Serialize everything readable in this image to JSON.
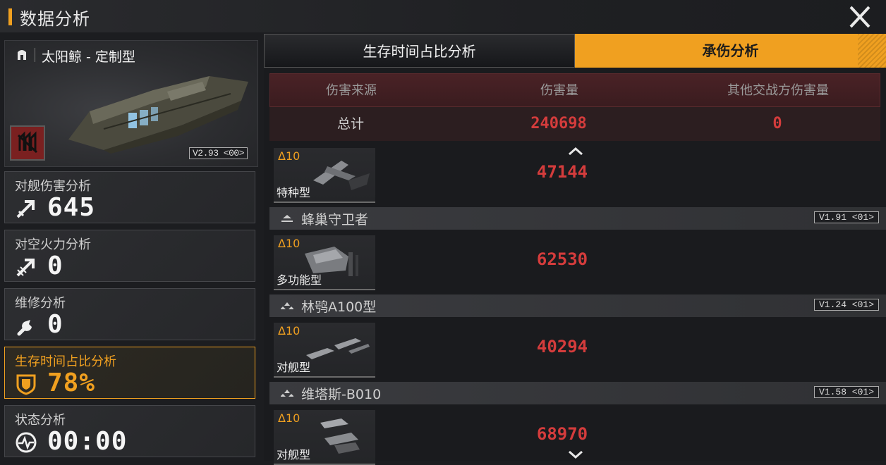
{
  "window": {
    "title": "数据分析"
  },
  "ship": {
    "name": "太阳鲸 - 定制型",
    "version": "V2.93 <00>"
  },
  "stats": [
    {
      "label": "对舰伤害分析",
      "value": "645",
      "icon": "anti-ship-icon"
    },
    {
      "label": "对空火力分析",
      "value": "0",
      "icon": "anti-air-icon"
    },
    {
      "label": "维修分析",
      "value": "0",
      "icon": "wrench-icon"
    },
    {
      "label": "生存时间占比分析",
      "value": "78%",
      "icon": "shield-icon",
      "active": true
    },
    {
      "label": "状态分析",
      "value": "00:00",
      "icon": "pulse-icon"
    }
  ],
  "tabs": [
    {
      "label": "生存时间占比分析",
      "active": false
    },
    {
      "label": "承伤分析",
      "active": true
    }
  ],
  "table": {
    "headers": [
      "伤害来源",
      "伤害量",
      "其他交战方伤害量"
    ],
    "total": {
      "label": "总计",
      "damage": "240698",
      "other": "0"
    }
  },
  "rows": [
    {
      "group": null,
      "level": "Δ10",
      "unit": "特种型",
      "damage": "47144"
    },
    {
      "group": {
        "name": "蜂巢守卫者",
        "version": "V1.91 <01>"
      },
      "level": "Δ10",
      "unit": "多功能型",
      "damage": "62530"
    },
    {
      "group": {
        "name": "林鸮A100型",
        "version": "V1.24 <01>"
      },
      "level": "Δ10",
      "unit": "对舰型",
      "damage": "40294"
    },
    {
      "group": {
        "name": "维塔斯-B010",
        "version": "V1.58 <01>"
      },
      "level": "Δ10",
      "unit": "对舰型",
      "damage": "68970"
    }
  ],
  "colors": {
    "accent": "#f0a020",
    "damage_red": "#d43c3c"
  }
}
